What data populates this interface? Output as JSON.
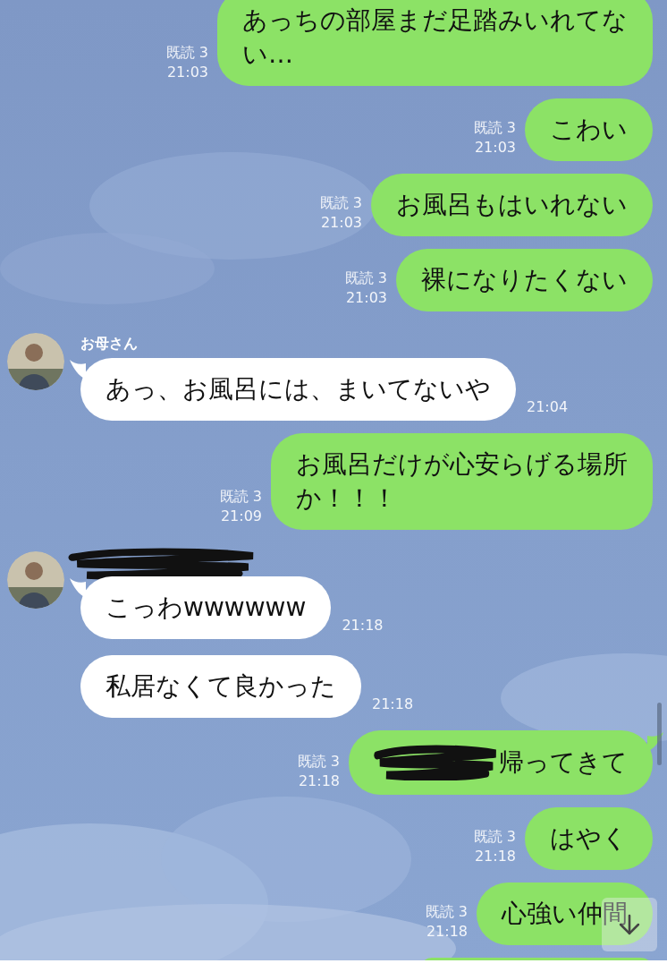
{
  "messages": [
    {
      "kind": "sent",
      "lines": [
        "あっちの部屋まだ足踏みいれてな",
        "い…"
      ],
      "read": "既読 3",
      "time": "21:03",
      "tail": false
    },
    {
      "kind": "sent",
      "lines": [
        "こわい"
      ],
      "read": "既読 3",
      "time": "21:03",
      "tail": false
    },
    {
      "kind": "sent",
      "lines": [
        "お風呂もはいれない"
      ],
      "read": "既読 3",
      "time": "21:03",
      "tail": false
    },
    {
      "kind": "sent",
      "lines": [
        "裸になりたくない"
      ],
      "read": "既読 3",
      "time": "21:03",
      "tail": false
    },
    {
      "kind": "received",
      "sender": {
        "kind": "name",
        "name": "お母さん"
      },
      "lines": [
        "あっ、お風呂には、まいてないや"
      ],
      "time": "21:04",
      "tail": true
    },
    {
      "kind": "sent",
      "lines": [
        "お風呂だけが心安らげる場所",
        "か！！！"
      ],
      "read": "既読 3",
      "time": "21:09",
      "tail": false
    },
    {
      "kind": "received",
      "sender": {
        "kind": "scribbled"
      },
      "lines": [
        "こっわwwwwww"
      ],
      "time": "21:18",
      "tail": true
    },
    {
      "kind": "received",
      "lines": [
        "私居なくて良かった"
      ],
      "time": "21:18",
      "tail": false
    },
    {
      "kind": "sent",
      "scribbled_prefix": true,
      "lines": [
        "帰ってきて"
      ],
      "read": "既読 3",
      "time": "21:18",
      "tail": true
    },
    {
      "kind": "sent",
      "lines": [
        "はやく"
      ],
      "read": "既読 3",
      "time": "21:18",
      "tail": false
    },
    {
      "kind": "sent",
      "lines": [
        "心強い仲間"
      ],
      "read": "既読 3",
      "time": "21:18",
      "tail": false
    },
    {
      "kind": "cut"
    }
  ]
}
